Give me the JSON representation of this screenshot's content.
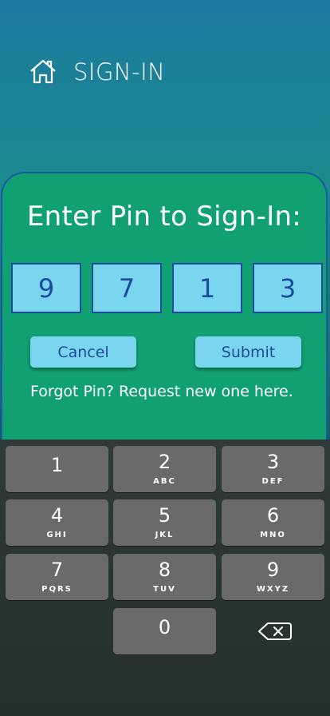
{
  "header": {
    "title": "SIGN-IN",
    "icon": "home-icon"
  },
  "card": {
    "title": "Enter  Pin to Sign-In:",
    "pin_digits": [
      "9",
      "7",
      "1",
      "3"
    ],
    "cancel_label": "Cancel",
    "submit_label": "Submit",
    "forgot_text": "Forgot  Pin?  Request new one here."
  },
  "keypad": {
    "keys": [
      {
        "digit": "1",
        "letters": ""
      },
      {
        "digit": "2",
        "letters": "ABC"
      },
      {
        "digit": "3",
        "letters": "DEF"
      },
      {
        "digit": "4",
        "letters": "GHI"
      },
      {
        "digit": "5",
        "letters": "JKL"
      },
      {
        "digit": "6",
        "letters": "MNO"
      },
      {
        "digit": "7",
        "letters": "PQRS"
      },
      {
        "digit": "8",
        "letters": "TUV"
      },
      {
        "digit": "9",
        "letters": "WXYZ"
      },
      {
        "digit": "0",
        "letters": ""
      }
    ],
    "backspace_icon": "backspace-icon"
  },
  "colors": {
    "card_bg": "#11a072",
    "pin_box_bg": "#7ad6ef",
    "pin_text": "#1c4a9e",
    "key_bg": "#6a6a6a"
  }
}
